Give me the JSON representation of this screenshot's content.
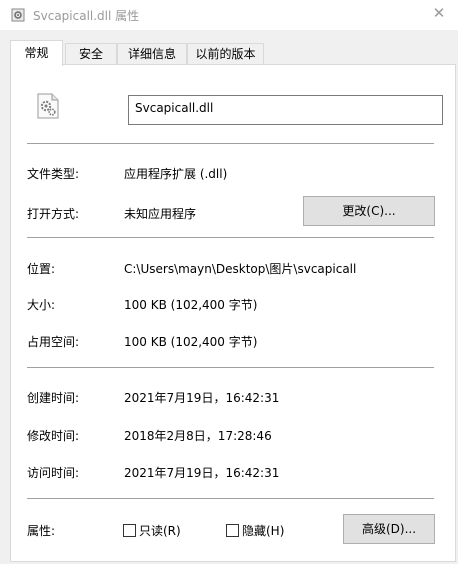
{
  "window": {
    "title": "Svcapicall.dll 属性",
    "close_glyph": "✕"
  },
  "tabs": [
    {
      "label": "常规",
      "active": true
    },
    {
      "label": "安全",
      "active": false
    },
    {
      "label": "详细信息",
      "active": false
    },
    {
      "label": "以前的版本",
      "active": false
    }
  ],
  "general": {
    "file_name": "Svcapicall.dll",
    "type_label": "文件类型:",
    "type_value": "应用程序扩展 (.dll)",
    "opens_label": "打开方式:",
    "opens_value": "未知应用程序",
    "change_button": "更改(C)...",
    "location_label": "位置:",
    "location_value": "C:\\Users\\mayn\\Desktop\\图片\\svcapicall",
    "size_label": "大小:",
    "size_value": "100 KB (102,400 字节)",
    "disk_size_label": "占用空间:",
    "disk_size_value": "100 KB (102,400 字节)",
    "created_label": "创建时间:",
    "created_value": "2021年7月19日，16:42:31",
    "modified_label": "修改时间:",
    "modified_value": "2018年2月8日，17:28:46",
    "accessed_label": "访问时间:",
    "accessed_value": "2021年7月19日，16:42:31",
    "attributes_label": "属性:",
    "readonly_label": "只读(R)",
    "readonly_checked": false,
    "hidden_label": "隐藏(H)",
    "hidden_checked": false,
    "advanced_button": "高级(D)..."
  },
  "icons": {
    "app": "dll-settings-icon",
    "file": "dll-file-icon"
  }
}
